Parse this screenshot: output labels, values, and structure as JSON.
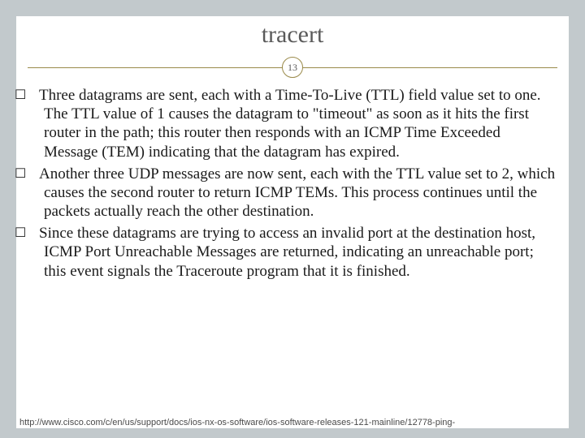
{
  "title": "tracert",
  "page_number": "13",
  "bullets": [
    "Three datagrams are sent, each with a Time-To-Live (TTL) field value set to one. The TTL value of 1 causes the datagram to \"timeout\" as soon as it hits the first router in the path; this router then responds with an ICMP Time Exceeded Message (TEM) indicating that the datagram has expired.",
    "Another three UDP messages are now sent, each with the TTL value set to 2, which causes the second router to return ICMP TEMs. This process continues until the packets actually reach the other destination.",
    "Since these datagrams are trying to access an invalid port at the destination host, ICMP Port Unreachable Messages are returned, indicating an unreachable port; this event signals the Traceroute program that it is finished."
  ],
  "footer_url": "http://www.cisco.com/c/en/us/support/docs/ios-nx-os-software/ios-software-releases-121-mainline/12778-ping-"
}
